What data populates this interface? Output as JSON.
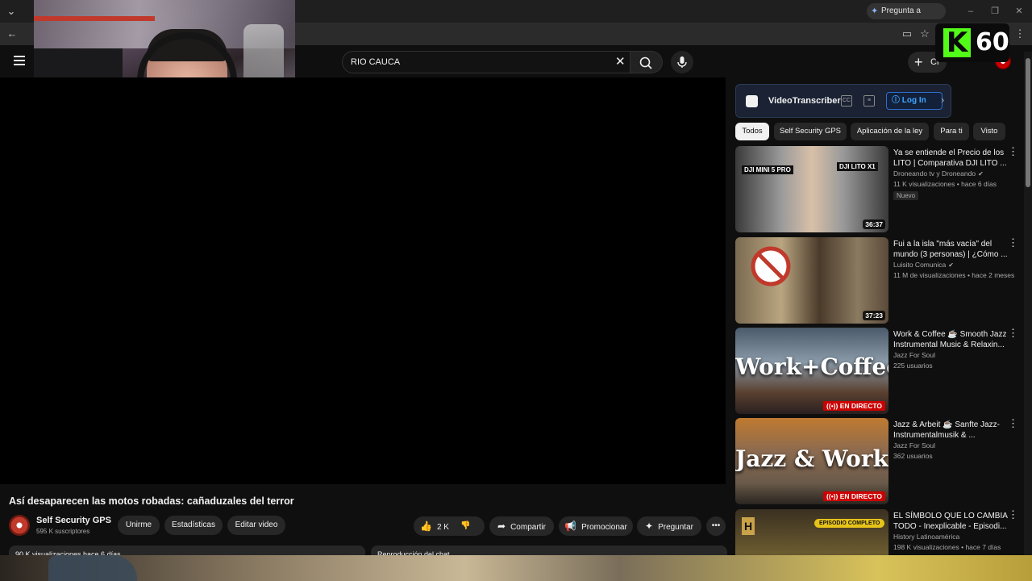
{
  "browser": {
    "gemini_label": "Pregunta a Gemini",
    "window_controls": [
      "–",
      "❐",
      "✕"
    ]
  },
  "kick": {
    "viewers": "60"
  },
  "header": {
    "search_value": "RIO CAUCA",
    "create_label": "Cr"
  },
  "video": {
    "title": "Así desaparecen las motos robadas: cañaduzales del terror",
    "channel_name": "Self Security GPS",
    "channel_subs": "595 K suscriptores",
    "join_label": "Unirme",
    "stats_label": "Estadísticas",
    "edit_label": "Editar video",
    "likes": "2 K",
    "share_label": "Compartir",
    "promote_label": "Promocionar",
    "ask_label": "Preguntar",
    "desc_preview": "90 K visualizaciones  hace 6 días",
    "chat_preview": "Reproducción del chat"
  },
  "extension": {
    "name": "VideoTranscriber",
    "login_label": "Log In"
  },
  "chips": [
    "Todos",
    "Self Security GPS",
    "Aplicación de la ley",
    "Para ti",
    "Visto"
  ],
  "recommendations": [
    {
      "title": "Ya se entiende el Precio de los LITO | Comparativa DJI LITO ...",
      "channel": "Droneando tv y Droneando",
      "meta": "11 K visualizaciones • hace 6 días",
      "badge": "Nuevo",
      "duration": "36:37",
      "overlay_left": "DJI MINI 5 PRO",
      "overlay_right": "DJI LITO X1"
    },
    {
      "title": "Fui a la isla \"más vacía\" del mundo (3 personas) | ¿Cómo ...",
      "channel": "Luisito Comunica",
      "meta": "11 M de visualizaciones • hace 2 meses",
      "duration": "37:23"
    },
    {
      "title": "Work & Coffee ☕ Smooth Jazz Instrumental Music & Relaxin...",
      "channel": "Jazz For Soul",
      "meta": "225 usuarios",
      "live": "EN DIRECTO",
      "overlay": "Work+Coffee"
    },
    {
      "title": "Jazz & Arbeit ☕ Sanfte Jazz-Instrumentalmusik & ...",
      "channel": "Jazz For Soul",
      "meta": "362 usuarios",
      "live": "EN DIRECTO",
      "overlay": "Jazz & Work"
    },
    {
      "title": "EL SÍMBOLO QUE LO CAMBIA TODO - Inexplicable - Episodi...",
      "channel": "History Latinoamérica",
      "meta": "198 K visualizaciones • hace 7 días",
      "overlay": "EPISODIO COMPLETO"
    }
  ]
}
